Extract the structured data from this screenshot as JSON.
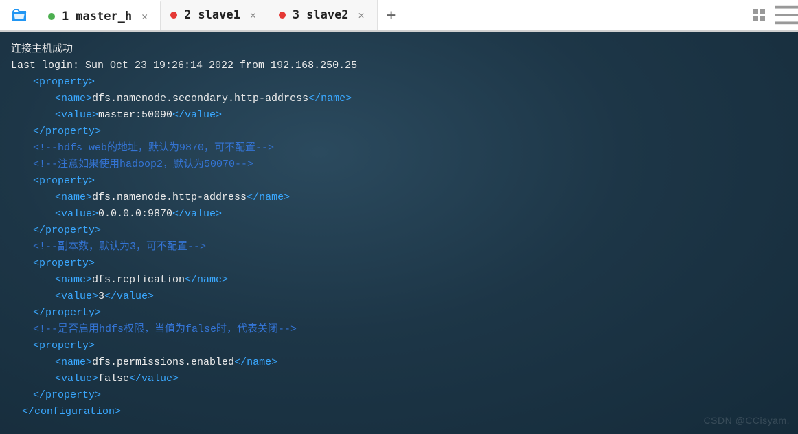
{
  "tabs": [
    {
      "num": "1",
      "label": "master_h",
      "status": "green"
    },
    {
      "num": "2",
      "label": "slave1",
      "status": "red"
    },
    {
      "num": "3",
      "label": "slave2",
      "status": "red"
    }
  ],
  "terminal": {
    "line1": "连接主机成功",
    "line2": "Last login: Sun Oct 23 19:26:14 2022 from 192.168.250.25",
    "tags": {
      "property_open": "<property>",
      "property_close": "</property>",
      "name_open": "<name>",
      "name_close": "</name>",
      "value_open": "<value>",
      "value_close": "</value>",
      "config_close": "</configuration>"
    },
    "p1_name": "dfs.namenode.secondary.http-address",
    "p1_value": "master:50090",
    "c1": "<!--hdfs web的地址，默认为9870，可不配置-->",
    "c2": "<!--注意如果使用hadoop2，默认为50070-->",
    "p2_name": "dfs.namenode.http-address",
    "p2_value": "0.0.0.0:9870",
    "c3": "<!--副本数，默认为3，可不配置-->",
    "p3_name": "dfs.replication",
    "p3_value": "3",
    "c4": "<!--是否启用hdfs权限，当值为false时，代表关闭-->",
    "p4_name": "dfs.permissions.enabled",
    "p4_value": "false"
  },
  "watermark": "CSDN @CCisyam."
}
